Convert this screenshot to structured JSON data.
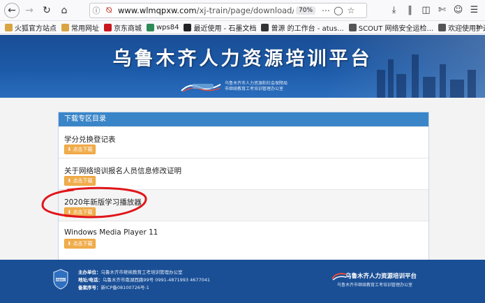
{
  "browser": {
    "url_host": "www.wlmqpxw.com",
    "url_path": "/xj-train/page/download/download.h",
    "zoom": "70%",
    "bookmarks": [
      {
        "label": "火狐官方站点",
        "icon": "folder-icon",
        "color": "#d9a441"
      },
      {
        "label": "常用网址",
        "icon": "folder-icon",
        "color": "#d9a441"
      },
      {
        "label": "京东商城",
        "icon": "jd-icon",
        "color": "#c9151e"
      },
      {
        "label": "wps84",
        "icon": "v-icon",
        "color": "#2e8b57"
      },
      {
        "label": "最近使用 - 石墨文档",
        "icon": "shimo-icon",
        "color": "#222222"
      },
      {
        "label": "曾源 的工作台 - atus...",
        "icon": "atus-icon",
        "color": "#333333"
      },
      {
        "label": "SCOUT 网络安全运检...",
        "icon": "globe-icon",
        "color": "#555555"
      },
      {
        "label": "欢迎使用护边员综合...",
        "icon": "globe-icon",
        "color": "#555555"
      }
    ]
  },
  "banner": {
    "title": "乌鲁木齐人力资源培训平台",
    "org_line1": "乌鲁木齐市人力资源和社会保障局",
    "org_line2": "市继续教育工考培训管理办公室"
  },
  "panel": {
    "header": "下载专区目录",
    "button_label": "点击下载",
    "items": [
      {
        "title": "学分兑换登记表"
      },
      {
        "title": "关于网络培训报名人员信息修改证明"
      },
      {
        "title": "2020年新版学习播放器"
      },
      {
        "title": "Windows Media Player 11"
      }
    ]
  },
  "footer": {
    "badge_text": "新疆单位",
    "sponsor_label": "主办单位：",
    "sponsor": "乌鲁木齐市继续教育工考培训管理办公室",
    "address_label": "地址/电话：",
    "address": "乌鲁木齐市南湖西路99号 0991-4871993 4677041",
    "icp_label": "备案序号：",
    "icp": "新ICP备08100726号-1",
    "logo_title": "乌鲁木齐人力资源培训平台",
    "logo_sub": "乌鲁木齐市继续教育工考培训管理办公室"
  }
}
